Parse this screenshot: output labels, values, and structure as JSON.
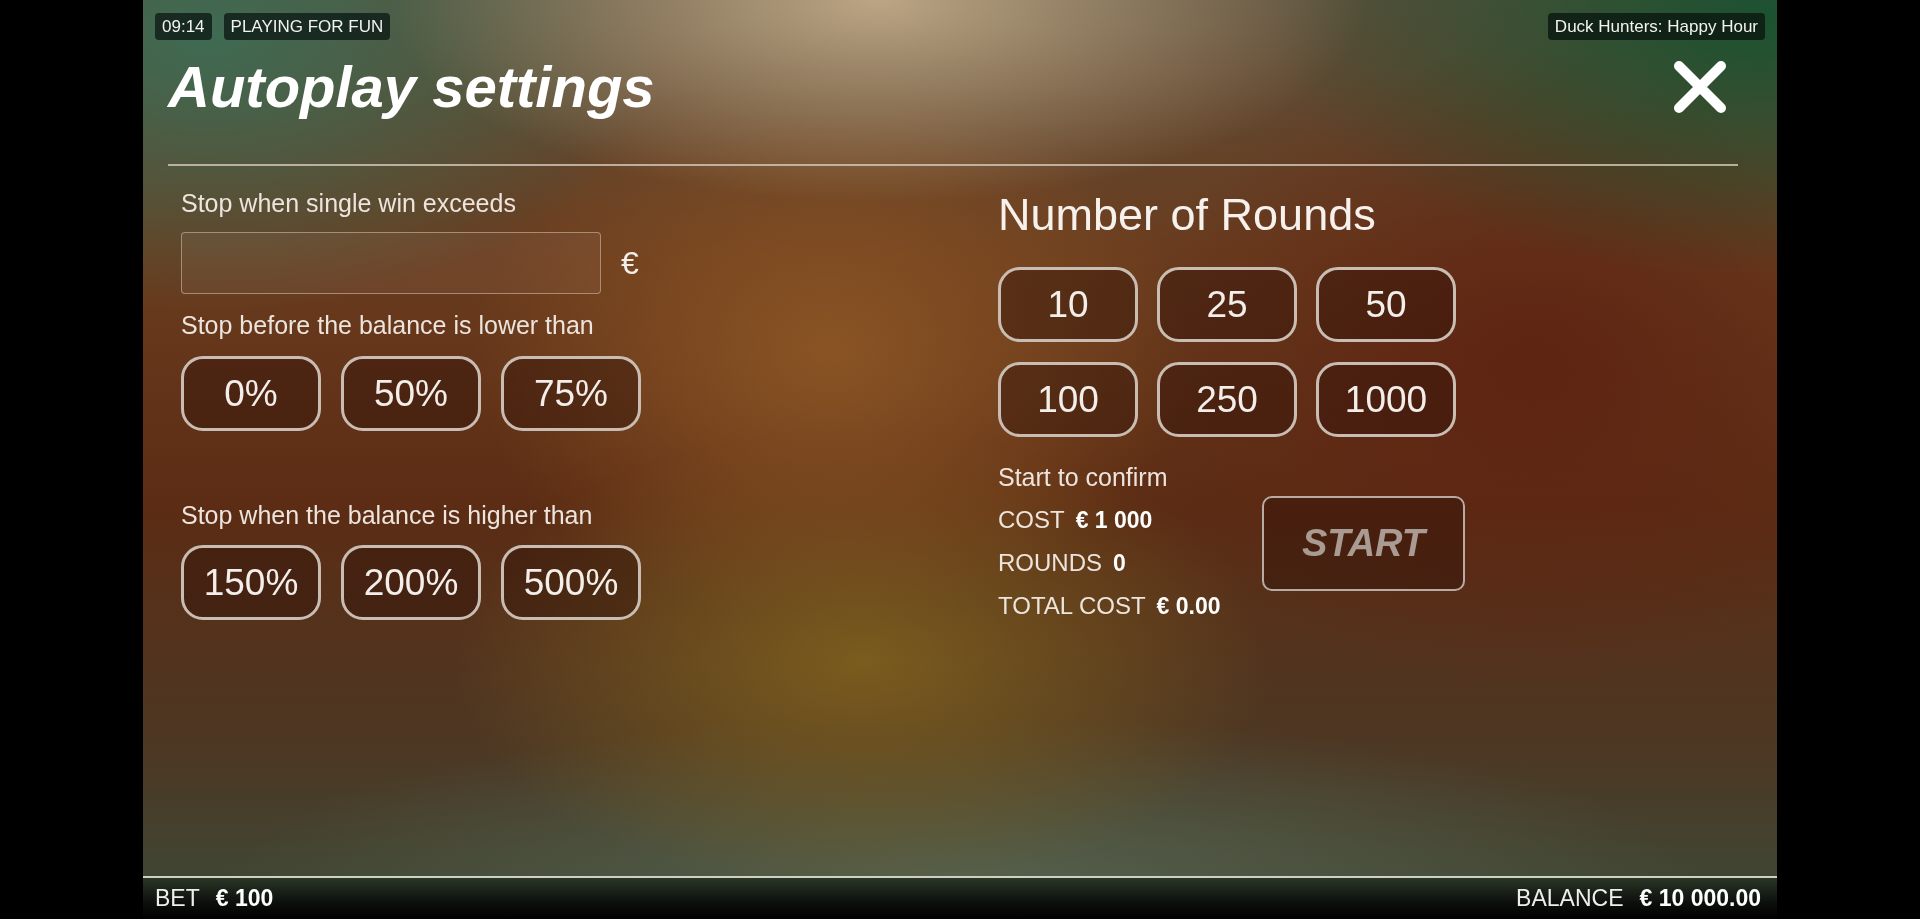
{
  "status": {
    "time": "09:14",
    "mode": "PLAYING FOR FUN",
    "game_title": "Duck Hunters: Happy Hour"
  },
  "dialog": {
    "title": "Autoplay settings"
  },
  "single_win_limit": {
    "label": "Stop when single win exceeds",
    "currency": "€"
  },
  "loss_limit": {
    "label": "Stop before the balance is lower than",
    "options": [
      {
        "label": "0%",
        "selected": false
      },
      {
        "label": "50%",
        "selected": false
      },
      {
        "label": "75%",
        "selected": false
      }
    ]
  },
  "win_limit": {
    "label": "Stop when the balance is higher than",
    "options": [
      {
        "label": "150%",
        "selected": false
      },
      {
        "label": "200%",
        "selected": false
      },
      {
        "label": "500%",
        "selected": false
      }
    ]
  },
  "rounds": {
    "title": "Number of Rounds",
    "options": [
      {
        "label": "10",
        "selected": false
      },
      {
        "label": "25",
        "selected": false
      },
      {
        "label": "50",
        "selected": false
      },
      {
        "label": "100",
        "selected": false
      },
      {
        "label": "250",
        "selected": false
      },
      {
        "label": "1000",
        "selected": false
      }
    ]
  },
  "confirmation": {
    "hint": "Start to confirm",
    "summary": [
      {
        "label": "COST",
        "value": "€ 1 000"
      },
      {
        "label": "ROUNDS",
        "value": "0"
      },
      {
        "label": "TOTAL COST",
        "value": "€ 0.00"
      }
    ],
    "start_button": {
      "label": "START",
      "disabled": true
    }
  },
  "footer": {
    "bet_label": "BET",
    "bet_value": "€ 100",
    "balance_label": "BALANCE",
    "balance_value": "€ 10 000.00"
  }
}
